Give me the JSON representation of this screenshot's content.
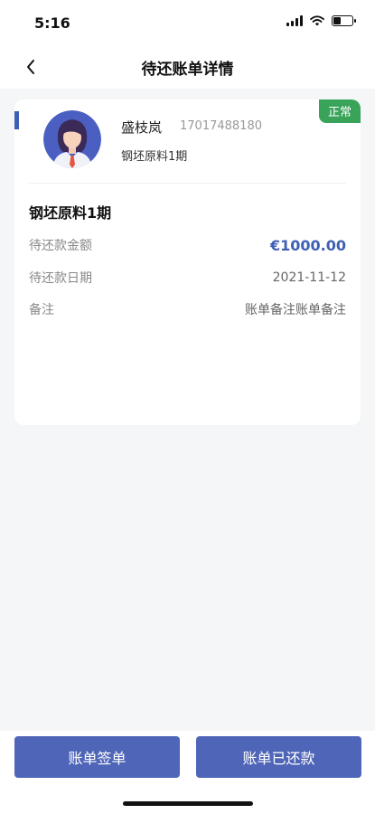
{
  "status_bar": {
    "time": "5:16"
  },
  "nav": {
    "title": "待还账单详情"
  },
  "card": {
    "status_badge": "正常",
    "user": {
      "name": "盛枝岚",
      "phone": "17017488180",
      "material": "钢坯原料1期"
    },
    "bill": {
      "title": "钢坯原料1期",
      "rows": [
        {
          "label": "待还款金额",
          "value": "€1000.00"
        },
        {
          "label": "待还款日期",
          "value": "2021-11-12"
        },
        {
          "label": "备注",
          "value": "账单备注账单备注"
        }
      ]
    }
  },
  "actions": {
    "left_button": "账单签单",
    "right_button": "账单已还款"
  },
  "colors": {
    "accent": "#3f5fb5",
    "button": "#4f65b8",
    "badge": "#3aa35a"
  }
}
